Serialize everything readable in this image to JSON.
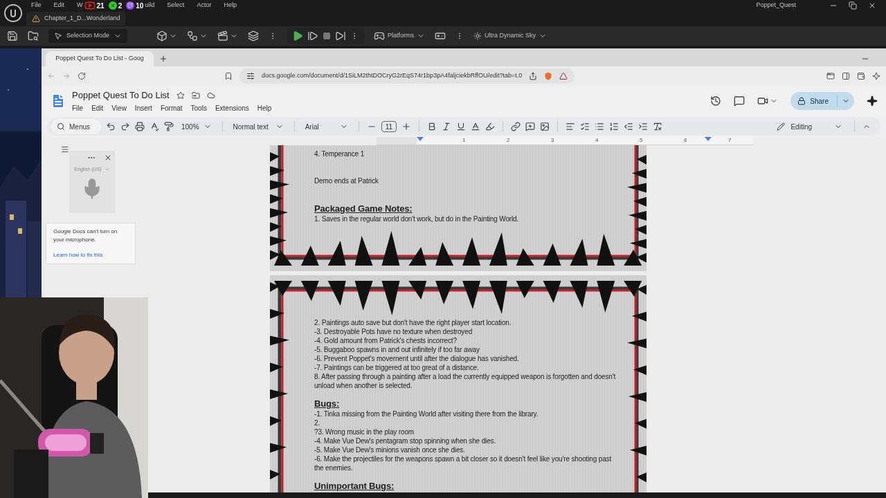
{
  "ue": {
    "menu": [
      "File",
      "Edit",
      "W"
    ],
    "menu_after": [
      "uild",
      "Select",
      "Actor",
      "Help"
    ],
    "badges": [
      {
        "kind": "youtube",
        "count": "21"
      },
      {
        "kind": "xbox",
        "count": "2"
      },
      {
        "kind": "twitch",
        "count": "10"
      }
    ],
    "level_tab": "Chapter_1_D...Wonderland",
    "project": "Poppet_Quest",
    "toolbar": {
      "mode": "Selection Mode",
      "platforms": "Platforms",
      "sky": "Ultra Dynamic Sky"
    }
  },
  "browser": {
    "tabs": [
      {
        "title": "Poppet Quest To Do List - Goog",
        "selected": true
      }
    ],
    "url": "docs.google.com/document/d/1SiLM2thtDOCryG2rEqS74r1bp3pA4faljciekbRffOU/edit?tab=t.0"
  },
  "docs": {
    "title": "Poppet Quest To Do List",
    "menu": [
      "File",
      "Edit",
      "View",
      "Insert",
      "Format",
      "Tools",
      "Extensions",
      "Help"
    ],
    "toolbar": {
      "search": "Menus",
      "zoom": "100%",
      "style": "Normal text",
      "font": "Arial",
      "size": "11",
      "mode": "Editing"
    },
    "share": "Share",
    "ruler": [
      "1",
      "2",
      "3",
      "4",
      "5",
      "6",
      "7"
    ]
  },
  "voice_typing": {
    "language": "English (US)",
    "message": "Google Docs can't turn on your microphone.",
    "link": "Learn how to fix this"
  },
  "pages": [
    {
      "sections": [
        {
          "lines": [
            "4. Temperance 1"
          ]
        },
        {
          "lines": [
            "Demo ends at Patrick"
          ]
        },
        {
          "heading": "Packaged Game Notes:",
          "lines": [
            "1. Saves in the regular world don't work, but do in the Painting World."
          ]
        }
      ]
    },
    {
      "sections": [
        {
          "lines": [
            "2. Paintings auto save but don't have the right player start location.",
            "-3. Destroyable Pots have no texture when destroyed",
            "-4. Gold amount from Patrick's chests incorrect?",
            "-5. Buggaboo spawns in and out infinitely if too far away",
            "-6. Prevent Poppet's movernent until after the dialogue has vanished.",
            "-7. Paintings can be triggered at too great of a distance.",
            "8. After passing through a painting after a load the currently equipped weapon is forgotten and doesn't unload when another is selected."
          ]
        },
        {
          "heading": "Bugs:",
          "lines": [
            "-1. Tinka missing from the Painting World after visiting there from the library.",
            "2.",
            "?3. Wrong music in the play room",
            "-4. Make Vue Dew's pentagram stop spinning when she dies.",
            "-5. Make Vue Dew's minions vanish once she dies.",
            "-6. Make the projectiles for the weapons spawn a bit closer so it doesn't feel like you're shooting past the enemies."
          ]
        },
        {
          "heading": "Unimportant Bugs:"
        }
      ]
    }
  ]
}
